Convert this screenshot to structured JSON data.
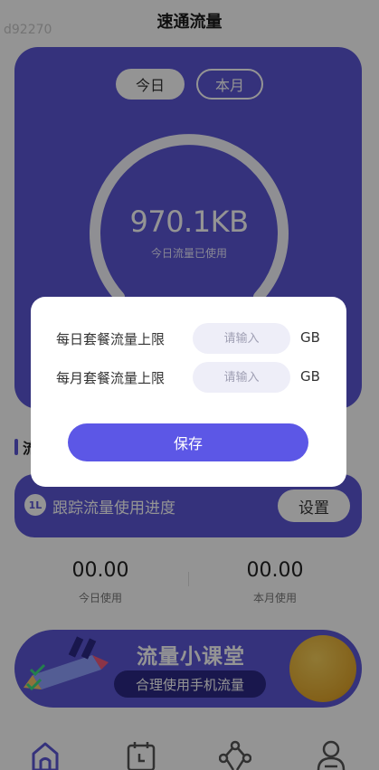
{
  "header": {
    "title": "速通流量",
    "watermark": "d92270"
  },
  "tabs": [
    {
      "label": "今日"
    },
    {
      "label": "本月"
    }
  ],
  "usage": {
    "value": "970.1KB",
    "label": "今日流量已使用"
  },
  "section": {
    "title": "流"
  },
  "tracker": {
    "icon_text": "1L",
    "label": "跟踪流量使用进度",
    "button_label": "设置"
  },
  "stats": {
    "today": {
      "value": "00.00",
      "label": "今日使用"
    },
    "month": {
      "value": "00.00",
      "label": "本月使用"
    }
  },
  "banner": {
    "title": "流量小课堂",
    "subtitle": "合理使用手机流量"
  },
  "bottom_nav": [
    "home-icon",
    "calendar-icon",
    "network-icon",
    "profile-icon"
  ],
  "dialog": {
    "daily": {
      "label": "每日套餐流量上限",
      "value": "",
      "placeholder": "请输入",
      "unit": "GB"
    },
    "monthly": {
      "label": "每月套餐流量上限",
      "value": "",
      "placeholder": "请输入",
      "unit": "GB"
    },
    "save_label": "保存"
  },
  "colors": {
    "accent": "#5c57d6",
    "button": "#5c57e6",
    "overlay": "rgba(0,0,0,0.42)"
  }
}
